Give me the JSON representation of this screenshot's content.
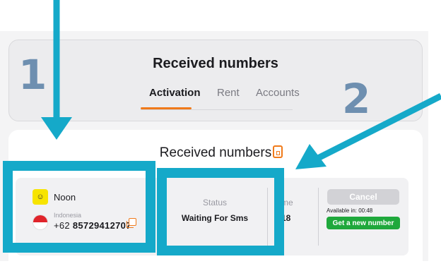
{
  "header": {
    "title": "Received numbers",
    "tabs": [
      {
        "label": "Activation",
        "active": true
      },
      {
        "label": "Rent",
        "active": false
      },
      {
        "label": "Accounts",
        "active": false
      }
    ]
  },
  "main": {
    "title": "Received numbers",
    "title_icon": "sim-card-icon"
  },
  "order": {
    "service_name": "Noon",
    "service_logo_glyph": "☺",
    "country": "Indonesia",
    "phone_prefix": "+62",
    "phone_number": "85729412707",
    "status_label": "Status",
    "status_value": "Waiting For Sms",
    "time_label": "me",
    "time_value": "18",
    "cancel_label": "Cancel",
    "available_text": "Available in: 00:48",
    "new_number_label": "Get a new number"
  },
  "annotations": {
    "label_1": "1",
    "label_2": "2",
    "color": "#15a9c9"
  },
  "colors": {
    "accent": "#f07a1a",
    "success": "#1fa83c",
    "disabled": "#d2d2d6"
  }
}
